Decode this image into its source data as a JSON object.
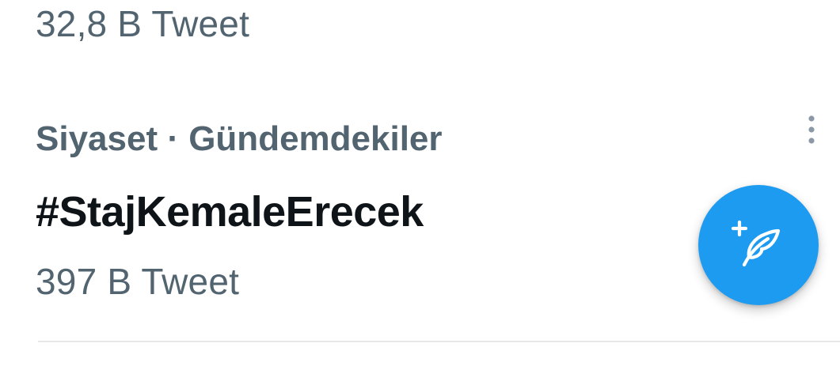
{
  "previous_trend": {
    "tweet_count": "32,8 B Tweet"
  },
  "trend": {
    "context": "Siyaset · Gündemdekiler",
    "title": "#StajKemaleErecek",
    "tweet_count": "397 B Tweet",
    "more_icon": "more-vertical-icon"
  },
  "compose_button": {
    "icon": "compose-tweet-icon",
    "color": "#1d9bf0"
  },
  "colors": {
    "secondary_text": "#536471",
    "primary_text": "#0f1419",
    "divider": "#e6e8ea"
  }
}
